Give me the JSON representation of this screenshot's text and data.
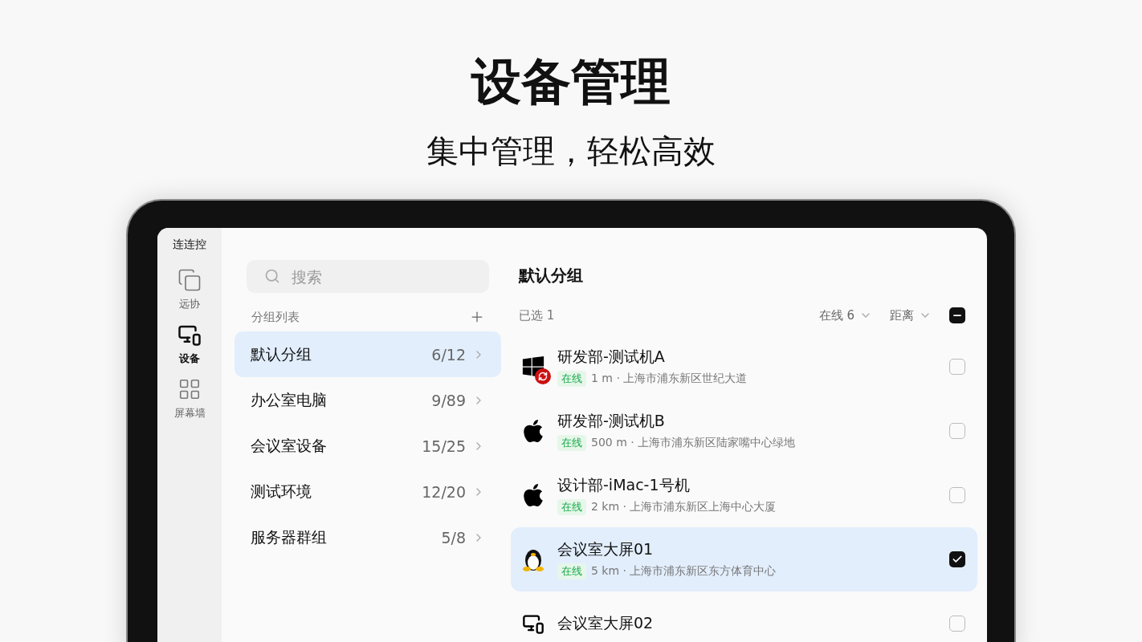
{
  "headline": "设备管理",
  "subheadline": "集中管理，轻松高效",
  "app": {
    "name": "连连控",
    "nav": [
      {
        "label": "远协",
        "kind": "copy",
        "selected": false
      },
      {
        "label": "设备",
        "kind": "devices",
        "selected": true
      },
      {
        "label": "屏幕墙",
        "kind": "grid",
        "selected": false
      }
    ],
    "search": {
      "placeholder": "搜索"
    },
    "groups_header": {
      "title": "分组列表"
    },
    "groups": [
      {
        "name": "默认分组",
        "count": "6/12",
        "selected": true
      },
      {
        "name": "办公室电脑",
        "count": "9/89",
        "selected": false
      },
      {
        "name": "会议室设备",
        "count": "15/25",
        "selected": false
      },
      {
        "name": "测试环境",
        "count": "12/20",
        "selected": false
      },
      {
        "name": "服务器群组",
        "count": "5/8",
        "selected": false
      }
    ],
    "detail": {
      "title": "默认分组",
      "selected_count": "已选 1",
      "filters": [
        {
          "label": "在线 6"
        },
        {
          "label": "距离"
        }
      ],
      "select_all": {
        "kind": "partial"
      },
      "devices": [
        {
          "name": "研发部-测试机A",
          "kind": "windows",
          "syncing": true,
          "status": "在线",
          "info": "1 m · 上海市浦东新区世纪大道",
          "checked": false
        },
        {
          "name": "研发部-测试机B",
          "kind": "apple",
          "syncing": false,
          "status": "在线",
          "info": "500 m · 上海市浦东新区陆家嘴中心绿地",
          "checked": false
        },
        {
          "name": "设计部-iMac-1号机",
          "kind": "apple",
          "syncing": false,
          "status": "在线",
          "info": "2 km · 上海市浦东新区上海中心大厦",
          "checked": false
        },
        {
          "name": "会议室大屏01",
          "kind": "linux",
          "syncing": false,
          "status": "在线",
          "info": "5 km · 上海市浦东新区东方体育中心",
          "checked": true
        },
        {
          "name": "会议室大屏02",
          "kind": "display",
          "syncing": false,
          "checked": false
        }
      ]
    }
  }
}
